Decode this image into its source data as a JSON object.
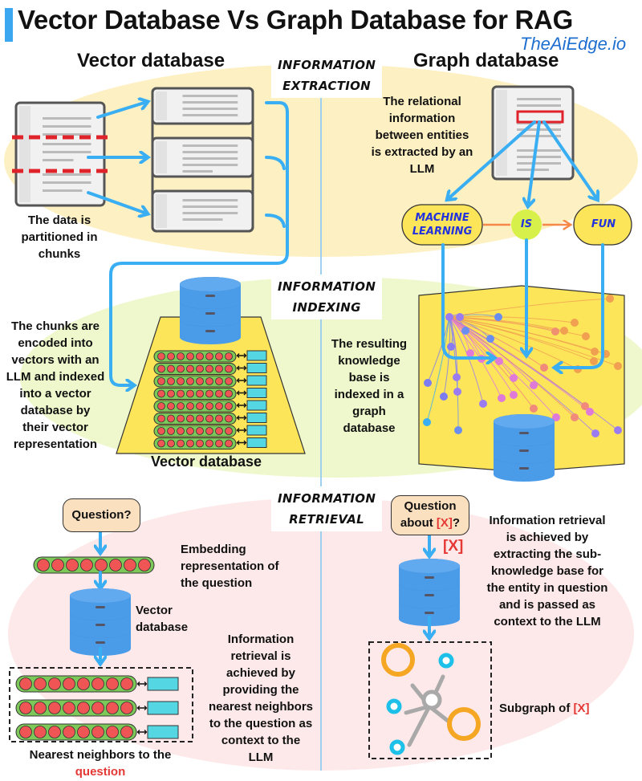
{
  "header": {
    "title": "Vector Database Vs Graph Database for RAG",
    "brand": "TheAiEdge.io"
  },
  "columns": {
    "left_title": "Vector database",
    "right_title": "Graph database"
  },
  "stages": [
    {
      "line1": "INFORMATION",
      "line2": "EXTRACTION"
    },
    {
      "line1": "INFORMATION",
      "line2": "INDEXING"
    },
    {
      "line1": "INFORMATION",
      "line2": "RETRIEVAL"
    }
  ],
  "extraction": {
    "vector_note": [
      "The data is",
      "partitioned in",
      "chunks"
    ],
    "graph_note": [
      "The relational",
      "information",
      "between entities",
      "is extracted by an",
      "LLM"
    ],
    "entities": {
      "machine_learning": [
        "MACHINE",
        "LEARNING"
      ],
      "is": "IS",
      "fun": "FUN"
    }
  },
  "indexing": {
    "vector_note": [
      "The chunks are",
      "encoded into",
      "vectors with an",
      "LLM and indexed",
      "into a vector",
      "database by",
      "their vector",
      "representation"
    ],
    "vector_db_label": "Vector database",
    "vector_rows": 8,
    "dots_per_vector": 8,
    "graph_note": [
      "The resulting",
      "knowledge",
      "base is",
      "indexed in a",
      "graph",
      "database"
    ]
  },
  "retrieval": {
    "vector": {
      "question": "Question?",
      "embedding_note": [
        "Embedding",
        "representation of",
        "the question"
      ],
      "db_label": [
        "Vector",
        "database"
      ],
      "neighbor_rows": 3,
      "note": [
        "Information",
        "retrieval is",
        "achieved by",
        "providing the",
        "nearest neighbors",
        "to the question as",
        "context to the",
        "LLM"
      ],
      "caption_line1": "Nearest neighbors to the",
      "caption_line2": "question"
    },
    "graph": {
      "question_line1": "Question",
      "question_line2_prefix": "about ",
      "question_entity": "[X]",
      "question_suffix": "?",
      "arrow_label": "[X]",
      "note": [
        "Information retrieval",
        "is achieved by",
        "extracting the sub-",
        "knowledge base for",
        "the entity in question",
        "and is passed as",
        "context to the LLM"
      ],
      "subgraph_label": "Subgraph of ",
      "subgraph_entity": "[X]"
    }
  },
  "colors": {
    "arrow": "#3aaef2",
    "extraction_bg": "#fdf0c2",
    "indexing_bg": "#eef8cc",
    "retrieval_bg": "#fde9e9",
    "db_blue": "#4a9be8",
    "accent_red": "#e53935",
    "vector_green": "#7cc95a",
    "vector_dot": "#f05555",
    "chunk_cyan": "#55d6e3",
    "entity_yellow": "#fde55a",
    "entity_text": "#2233dd"
  }
}
